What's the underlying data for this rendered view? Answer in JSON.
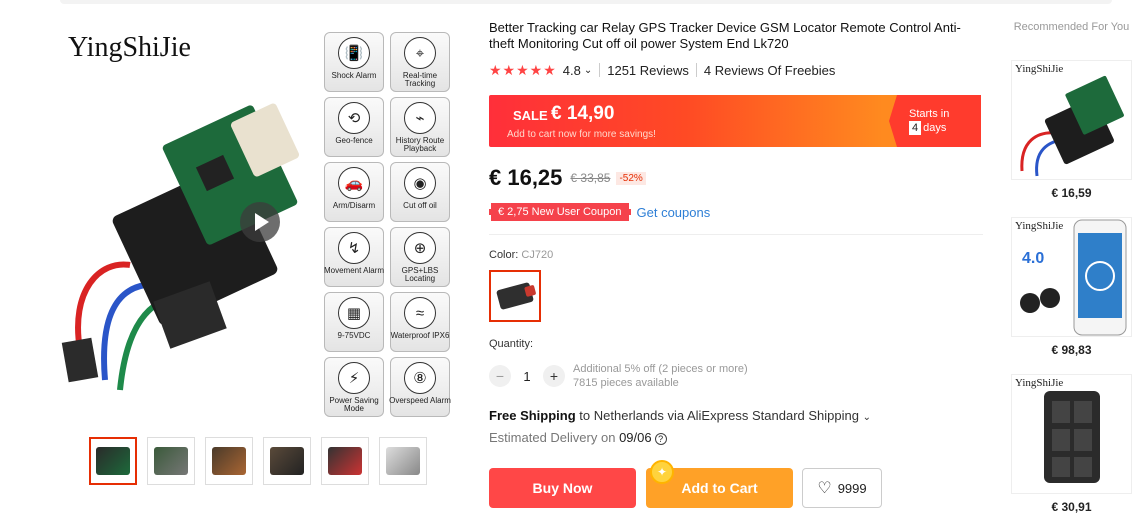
{
  "gallery": {
    "brand": "YingShiJie",
    "features": [
      {
        "label": "Shock Alarm",
        "icon": "phone-shake-icon"
      },
      {
        "label": "Real-time Tracking",
        "icon": "location-pin-icon"
      },
      {
        "label": "Geo-fence",
        "icon": "fence-icon"
      },
      {
        "label": "History Route Playback",
        "icon": "route-icon"
      },
      {
        "label": "Arm/Disarm",
        "icon": "car-icon"
      },
      {
        "label": "Cut off oil",
        "icon": "oil-icon"
      },
      {
        "label": "Movement Alarm",
        "icon": "movement-icon"
      },
      {
        "label": "GPS+LBS Locating",
        "icon": "satellite-icon"
      },
      {
        "label": "9-75VDC",
        "icon": "battery-icon"
      },
      {
        "label": "Waterproof IPX6",
        "icon": "water-icon"
      },
      {
        "label": "Power Saving Mode",
        "icon": "leaf-icon"
      },
      {
        "label": "Overspeed Alarm",
        "icon": "speed-icon"
      }
    ],
    "thumb_count": 6
  },
  "product": {
    "title": "Better Tracking car Relay GPS Tracker Device GSM Locator Remote Control Anti-theft Monitoring Cut off oil power System End Lk720",
    "stars": "★★★★★",
    "rating": "4.8",
    "reviews": "1251 Reviews",
    "freebies": "4 Reviews Of Freebies"
  },
  "sale": {
    "label": "SALE",
    "price": "€ 14,90",
    "note": "Add to cart now for more savings!",
    "starts_in": "Starts in",
    "days_num": "4",
    "days": "days"
  },
  "price": {
    "current": "€ 16,25",
    "original": "€ 33,85",
    "discount": "-52%"
  },
  "coupon": {
    "label": "€ 2,75 New User Coupon",
    "link": "Get coupons"
  },
  "color": {
    "label": "Color:",
    "value": "CJ720"
  },
  "quantity": {
    "label": "Quantity:",
    "value": "1",
    "minus": "−",
    "plus": "+",
    "note1": "Additional 5% off (2 pieces or more)",
    "note2": "7815 pieces available"
  },
  "shipping": {
    "free": "Free Shipping",
    "rest": "to Netherlands via AliExpress Standard Shipping",
    "est_label": "Estimated Delivery on",
    "date": "09/06",
    "help": "?"
  },
  "actions": {
    "buy": "Buy Now",
    "cart": "Add to Cart",
    "wish_count": "9999"
  },
  "recommended": {
    "header": "Recommended For You",
    "items": [
      {
        "brand": "YingShiJie",
        "price": "€ 16,59"
      },
      {
        "brand": "YingShiJie",
        "price": "€ 98,83"
      },
      {
        "brand": "YingShiJie",
        "price": "€ 30,91"
      }
    ]
  }
}
